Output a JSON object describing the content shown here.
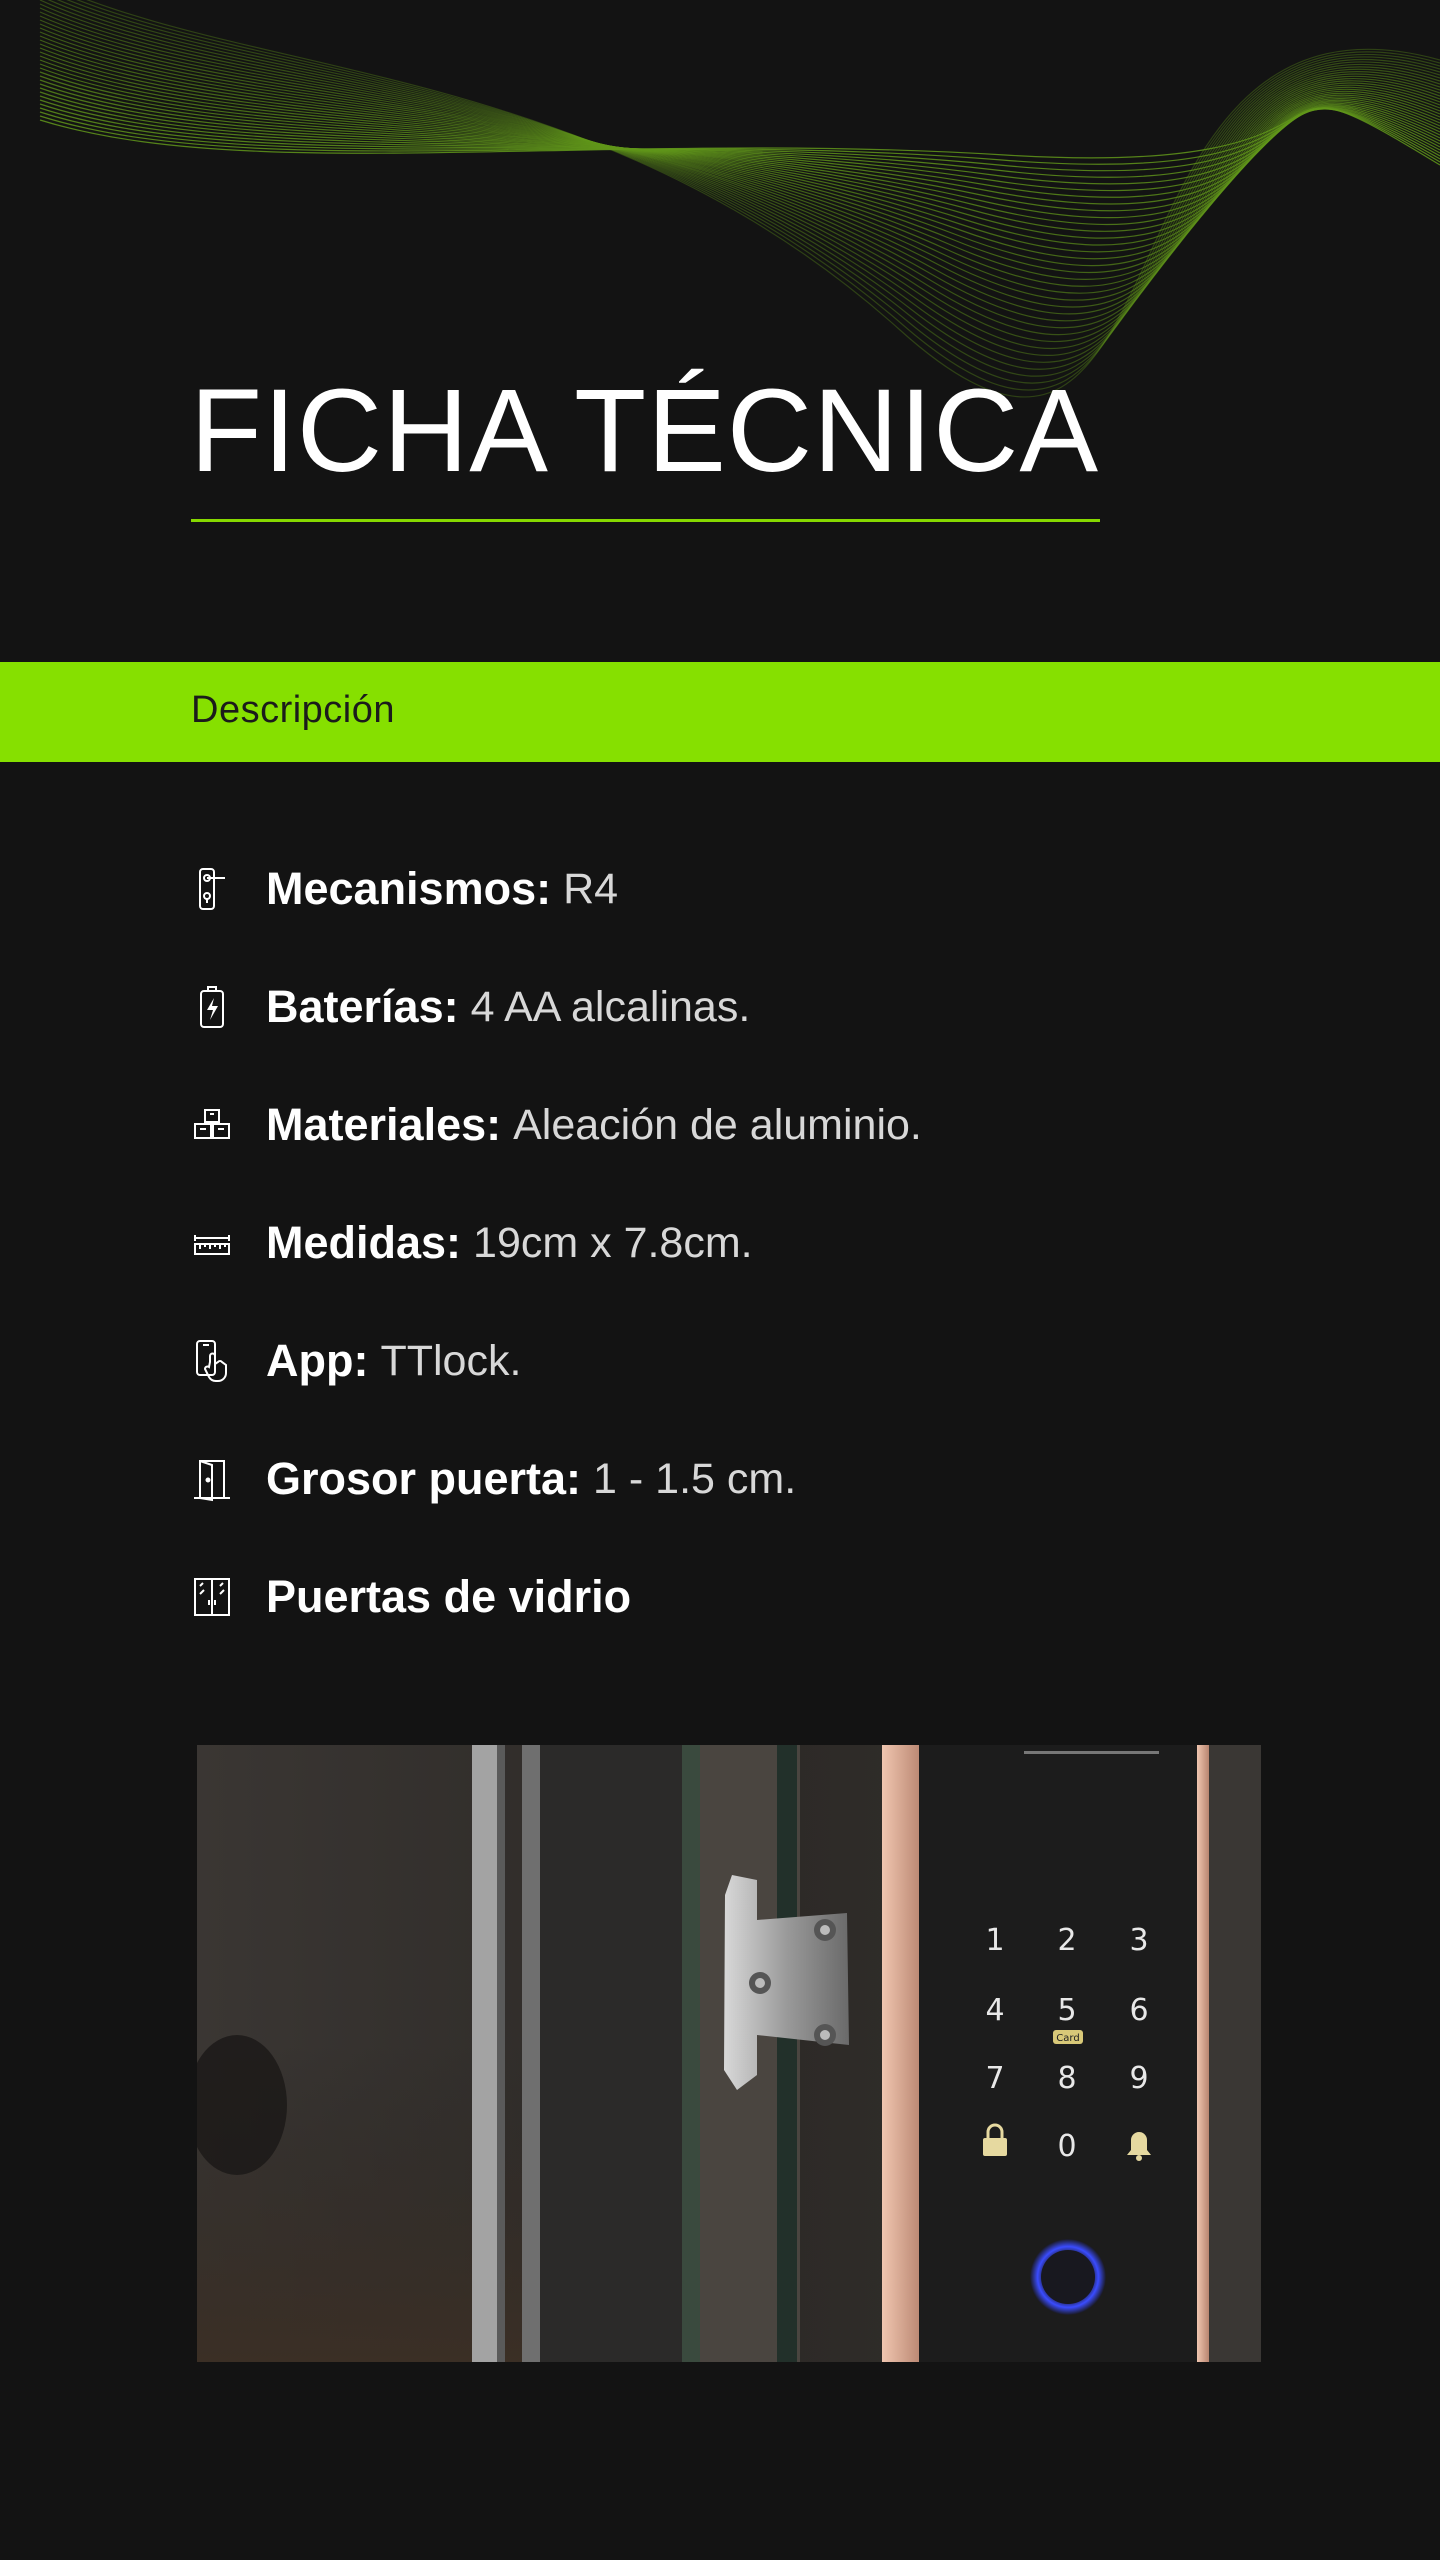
{
  "page": {
    "title": "FICHA TÉCNICA",
    "section_label": "Descripción",
    "accent_color": "#86e000",
    "background_color": "#131313"
  },
  "specs": [
    {
      "icon": "door-handle-icon",
      "label": "Mecanismos:",
      "value": "R4"
    },
    {
      "icon": "battery-icon",
      "label": "Baterías:",
      "value": "4 AA alcalinas."
    },
    {
      "icon": "boxes-icon",
      "label": "Materiales:",
      "value": "Aleación de aluminio."
    },
    {
      "icon": "ruler-icon",
      "label": "Medidas:",
      "value": "19cm x 7.8cm."
    },
    {
      "icon": "phone-touch-icon",
      "label": "App:",
      "value": "TTlock."
    },
    {
      "icon": "door-icon",
      "label": "Grosor puerta:",
      "value": "1 - 1.5 cm."
    },
    {
      "icon": "glass-doors-icon",
      "label": "Puertas de vidrio",
      "value": ""
    }
  ],
  "keypad": {
    "keys": [
      "1",
      "2",
      "3",
      "4",
      "5",
      "6",
      "7",
      "8",
      "9",
      "0"
    ],
    "card_label": "Card"
  }
}
